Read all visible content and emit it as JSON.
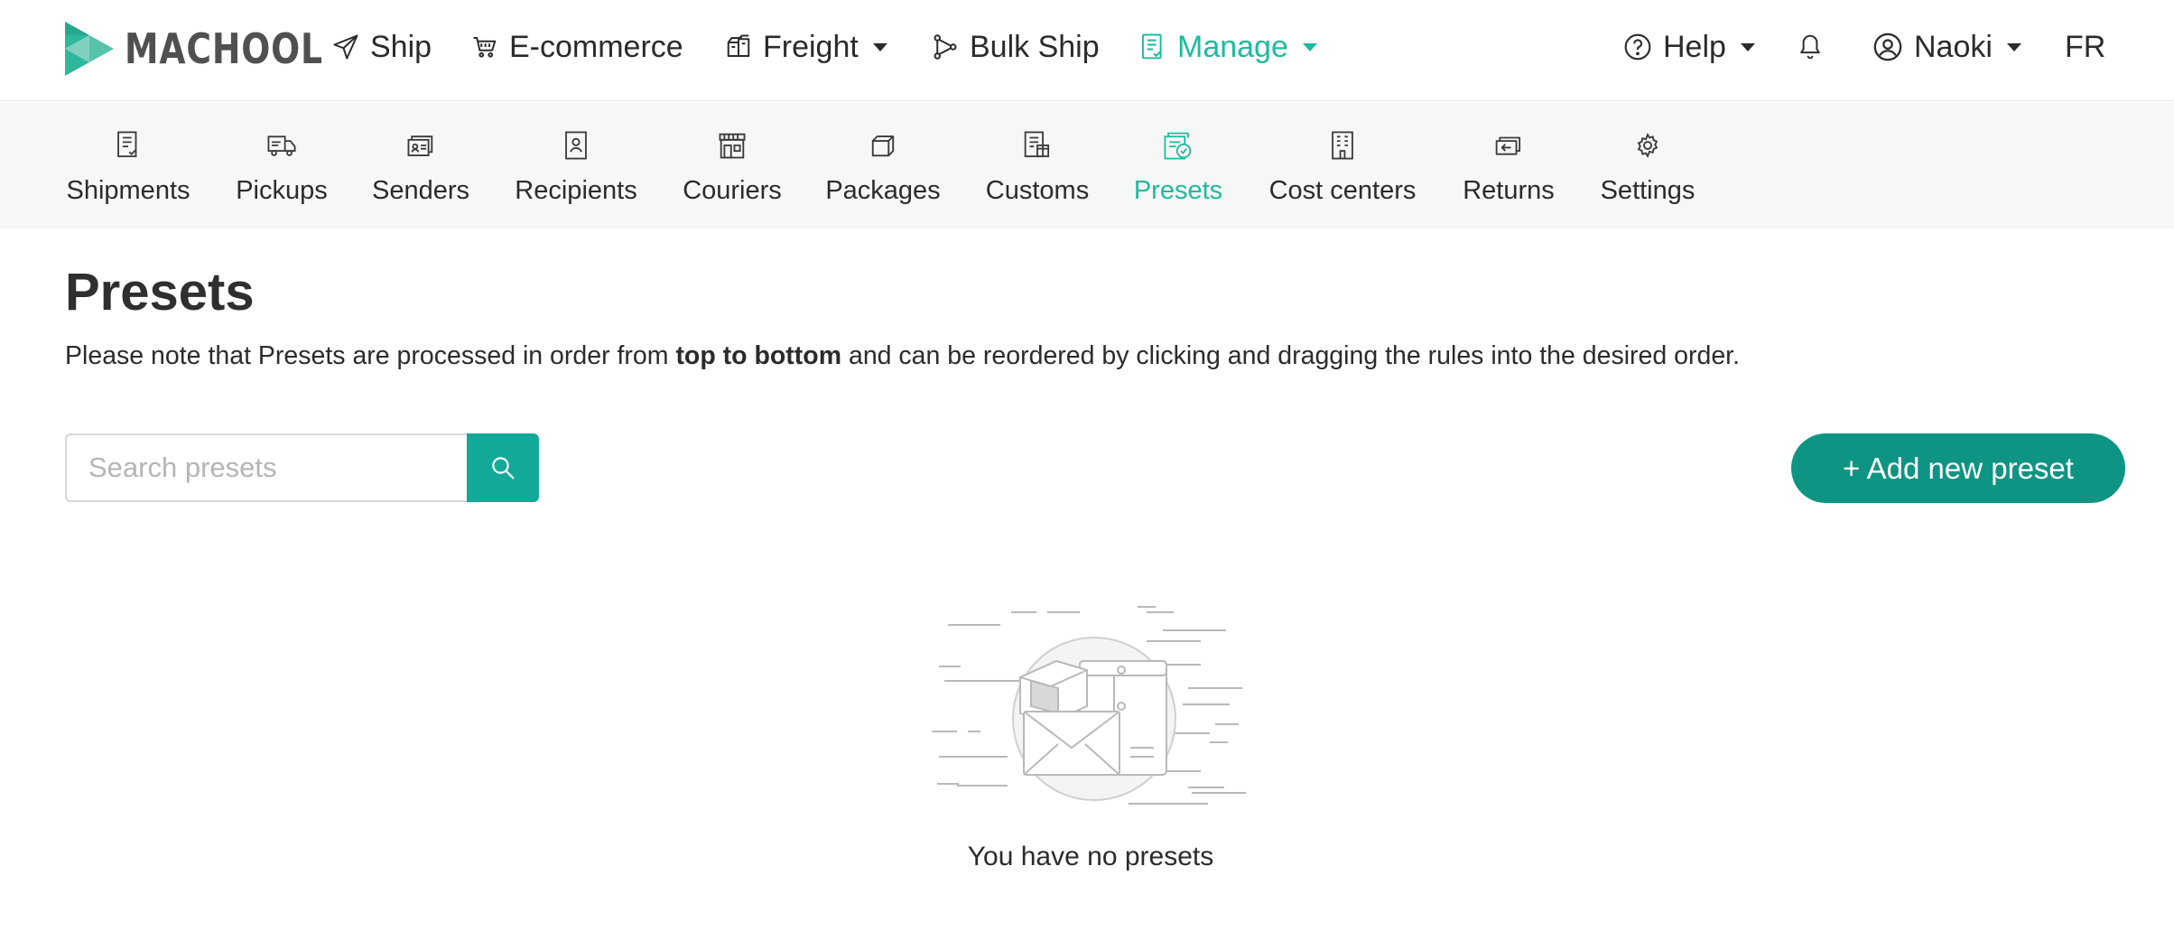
{
  "brand": {
    "name": "MACHOOL",
    "accent": "#1dbb9e",
    "button": "#0e9483"
  },
  "topnav": {
    "ship": "Ship",
    "ecommerce": "E-commerce",
    "freight": "Freight",
    "bulk_ship": "Bulk Ship",
    "manage": "Manage",
    "help": "Help",
    "user": "Naoki",
    "lang": "FR"
  },
  "subnav": {
    "items": [
      {
        "label": "Shipments",
        "icon": "shipments-icon"
      },
      {
        "label": "Pickups",
        "icon": "truck-icon"
      },
      {
        "label": "Senders",
        "icon": "senders-icon"
      },
      {
        "label": "Recipients",
        "icon": "recipient-icon"
      },
      {
        "label": "Couriers",
        "icon": "store-icon"
      },
      {
        "label": "Packages",
        "icon": "box-icon"
      },
      {
        "label": "Customs",
        "icon": "customs-icon"
      },
      {
        "label": "Presets",
        "icon": "presets-icon",
        "active": true
      },
      {
        "label": "Cost centers",
        "icon": "building-icon"
      },
      {
        "label": "Returns",
        "icon": "returns-icon"
      },
      {
        "label": "Settings",
        "icon": "gear-icon"
      }
    ]
  },
  "page": {
    "title": "Presets",
    "note_before": "Please note that Presets are processed in order from ",
    "note_bold": "top to bottom",
    "note_after": " and can be reordered by clicking and dragging the rules into the desired order.",
    "search_placeholder": "Search presets",
    "add_button": "+ Add new preset",
    "empty_text": "You have no presets"
  }
}
